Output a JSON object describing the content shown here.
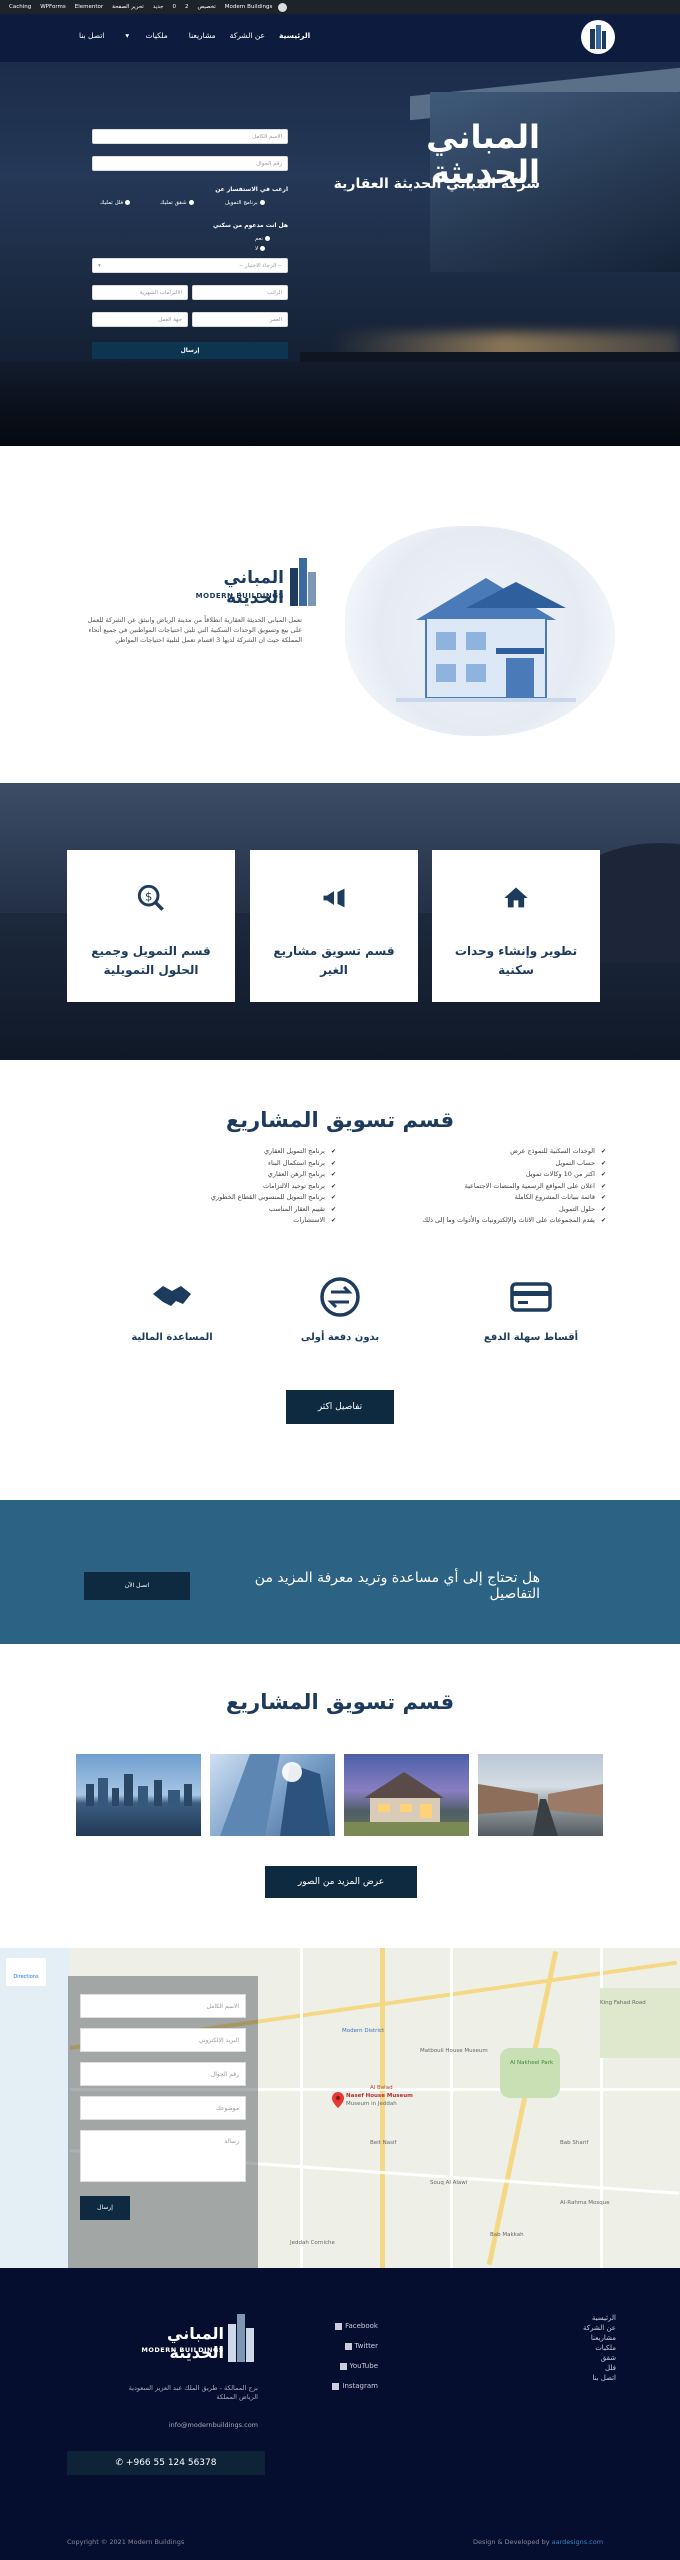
{
  "admin_bar": {
    "items": [
      "Modern Buildings",
      "تخصيص",
      "2",
      "0",
      "جديد",
      "تحرير الصفحة",
      "Elementor",
      "WPForms",
      "Caching"
    ]
  },
  "header": {
    "nav": [
      "الرئيسية",
      "عن الشركة",
      "مشاريعنا",
      "ملكيات",
      "اتصل بنا"
    ]
  },
  "hero": {
    "title": "المباني الحديثة",
    "subtitle": "شركة المباني الحديثة العقارية",
    "form": {
      "name_placeholder": "الاسم الكامل",
      "phone_placeholder": "رقم الجوال",
      "q1_label": "ارغب في الاستفسار عن",
      "q1_opt1": "برنامج التمويل",
      "q1_opt2": "شقق تمليك",
      "q1_opt3": "فلل تمليك",
      "q2_label": "هل انت مدعوم من سكني",
      "q2_opt1": "نعم",
      "q2_opt2": "لا",
      "select_placeholder": "-- الرجاء الاختيار --",
      "salary_placeholder": "الراتب",
      "obligations_placeholder": "الالتزامات الشهرية",
      "age_placeholder": "العمر",
      "employer_placeholder": "جهة العمل",
      "submit": "إرسال"
    }
  },
  "about": {
    "logo_ar": "المباني الحديثة",
    "logo_en": "MODERN BUILDINGS",
    "text": "تعمل المباني الحديثة العقارية انطلاقاً من مدينة الرياض وانبثق عن الشركة للعمل على بيع وتسويق الوحدات السكنية التي تلبي احتياجات المواطنين في جميع أنحاء المملكة حيث ان الشركة لديها 3 اقسام تعمل لتلبية احتياجات المواطن"
  },
  "services": [
    {
      "title": "تطوير وإنشاء وحدات سكنية",
      "icon": "home-icon"
    },
    {
      "title": "قسم تسويق مشاريع الغير",
      "icon": "megaphone-icon"
    },
    {
      "title": "قسم التمويل وجميع الحلول التمويلية",
      "icon": "money-icon"
    }
  ],
  "marketing": {
    "title": "قسم تسويق المشاريع",
    "col_right": [
      "الوحدات السكنية للنموذج عرض",
      "حساب التمويل",
      "اكثر من 10 وكالات تمويل",
      "اعلان على المواقع الرسمية والمنصات الاجتماعية",
      "قائمة ببيانات المشروع الكاملة",
      "حلول التمويل",
      "يقدم المجموعات على الاثاث والإلكترونيات والأدوات وما إلى ذلك"
    ],
    "col_left": [
      "برنامج التمويل العقاري",
      "برنامج استكمال البناء",
      "برنامج الرهن العقاري",
      "برنامج توحيد الالتزامات",
      "برنامج التمويل للمنسوبي القطاع الخطوري",
      "تقييم العقار المناسب",
      "الاستشارات"
    ],
    "features": [
      {
        "label": "أقساط سهلة الدفع",
        "icon": "credit-card-icon"
      },
      {
        "label": "بدون دفعة أولى",
        "icon": "exchange-icon"
      },
      {
        "label": "المساعدة المالية",
        "icon": "handshake-icon"
      }
    ],
    "button": "تفاصيل اكثر"
  },
  "cta": {
    "text": "هل تحتاج إلى أي مساعدة وتريد معرفة المزيد من التفاصيل",
    "button": "اتصل الآن"
  },
  "gallery": {
    "title": "قسم تسويق المشاريع",
    "button": "عرض المزيد من الصور"
  },
  "map": {
    "directions": "Directions",
    "pin_label": "Nasef House Museum",
    "pin_sub": "Museum in Jeddah",
    "labels": [
      "Modern District",
      "Matbouli House Museum",
      "Al Balad",
      "Bab Sharif",
      "Al Nakheel Park",
      "Beit Nasif",
      "Souq Al Alawi",
      "Al-Rahma Mosque",
      "Bab Makkah",
      "King Fahad Road",
      "Jeddah Corniche"
    ],
    "form": {
      "name": "الاسم الكامل",
      "email": "البريد الإلكتروني",
      "phone": "رقم الجوال",
      "subject": "موضوعك",
      "message": "رسالة",
      "submit": "إرسال"
    }
  },
  "footer": {
    "links": [
      "الرئيسية",
      "عن الشركة",
      "مشاريعنا",
      "ملكيات",
      "شقق",
      "فلل",
      "اتصل بنا"
    ],
    "social": [
      "Facebook",
      "Twitter",
      "YouTube",
      "Instagram"
    ],
    "logo_ar": "المباني الحديثة",
    "logo_en": "MODERN BUILDINGS",
    "address": "برج الممالكة - طريق الملك عبد العزيز السعودية الرياض المملكة",
    "email": "info@modernbuildings.com",
    "phone": "+966 55 124 56378",
    "copyright": "Copyright © 2021 Modern Buildings",
    "design_prefix": "Design & Developed by ",
    "design_name": "aardesigns.com"
  }
}
